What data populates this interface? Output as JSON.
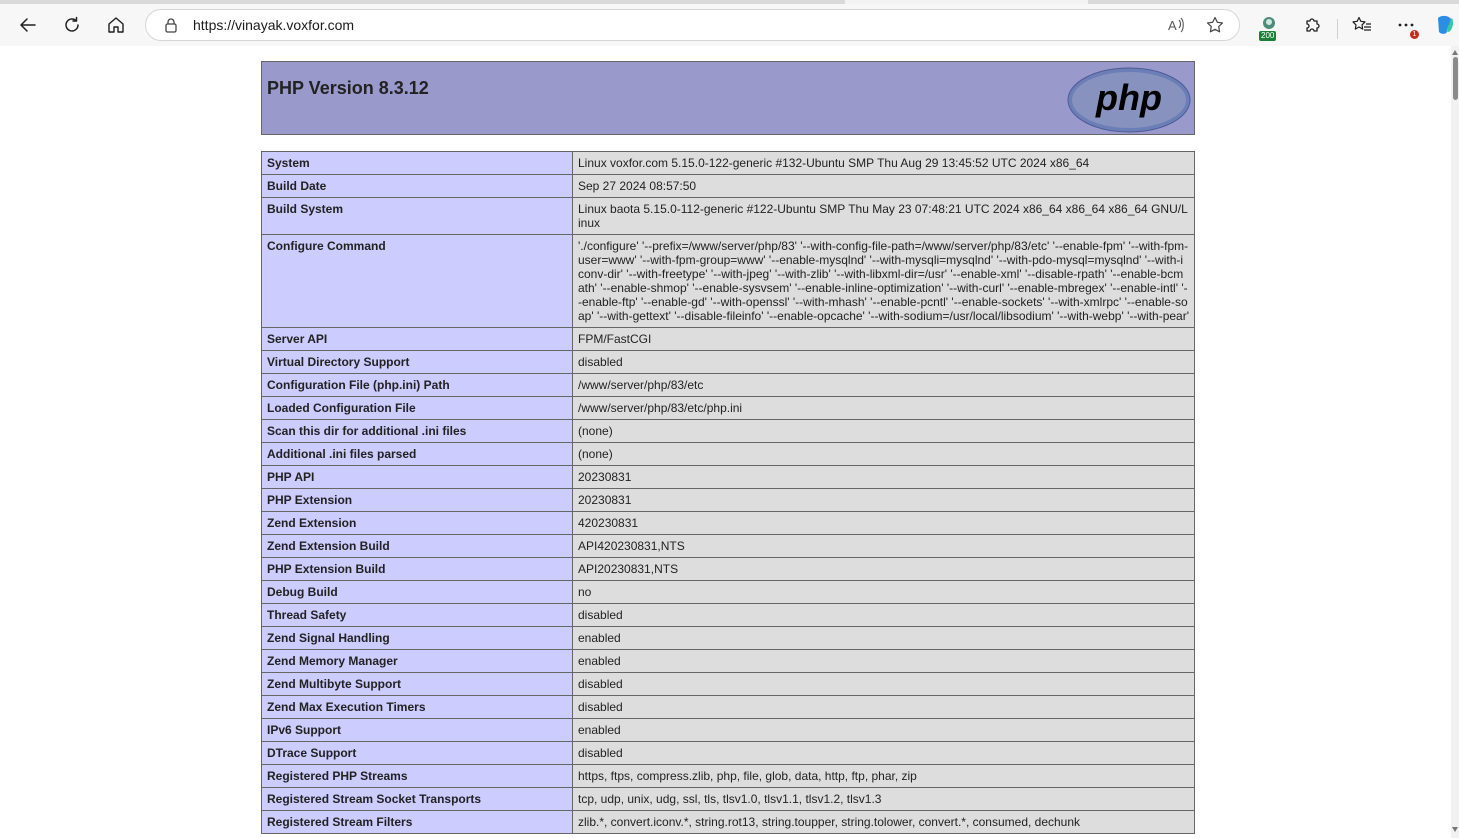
{
  "browser": {
    "url": "https://vinayak.voxfor.com",
    "extension_badge": "200",
    "menu_badge": "1",
    "toolbar_icons": [
      "back-icon",
      "refresh-icon",
      "home-icon",
      "lock-icon",
      "read-aloud-icon",
      "favorite-star-icon",
      "extension-icon",
      "puzzle-icon",
      "favorites-icon",
      "more-icon",
      "copilot-icon"
    ]
  },
  "page": {
    "title": "PHP Version 8.3.12",
    "logo_text": "php",
    "header_color": "#9999cc",
    "key_color": "#ccccff",
    "value_color": "#dddddd"
  },
  "rows": [
    {
      "k": "System",
      "v": "Linux voxfor.com 5.15.0-122-generic #132-Ubuntu SMP Thu Aug 29 13:45:52 UTC 2024 x86_64"
    },
    {
      "k": "Build Date",
      "v": "Sep 27 2024 08:57:50"
    },
    {
      "k": "Build System",
      "v": "Linux baota 5.15.0-112-generic #122-Ubuntu SMP Thu May 23 07:48:21 UTC 2024 x86_64 x86_64 x86_64 GNU/Linux"
    },
    {
      "k": "Configure Command",
      "v": "'./configure' '--prefix=/www/server/php/83' '--with-config-file-path=/www/server/php/83/etc' '--enable-fpm' '--with-fpm-user=www' '--with-fpm-group=www' '--enable-mysqlnd' '--with-mysqli=mysqlnd' '--with-pdo-mysql=mysqlnd' '--with-iconv-dir' '--with-freetype' '--with-jpeg' '--with-zlib' '--with-libxml-dir=/usr' '--enable-xml' '--disable-rpath' '--enable-bcmath' '--enable-shmop' '--enable-sysvsem' '--enable-inline-optimization' '--with-curl' '--enable-mbregex' '--enable-intl' '--enable-ftp' '--enable-gd' '--with-openssl' '--with-mhash' '--enable-pcntl' '--enable-sockets' '--with-xmlrpc' '--enable-soap' '--with-gettext' '--disable-fileinfo' '--enable-opcache' '--with-sodium=/usr/local/libsodium' '--with-webp' '--with-pear'"
    },
    {
      "k": "Server API",
      "v": "FPM/FastCGI"
    },
    {
      "k": "Virtual Directory Support",
      "v": "disabled"
    },
    {
      "k": "Configuration File (php.ini) Path",
      "v": "/www/server/php/83/etc"
    },
    {
      "k": "Loaded Configuration File",
      "v": "/www/server/php/83/etc/php.ini"
    },
    {
      "k": "Scan this dir for additional .ini files",
      "v": "(none)"
    },
    {
      "k": "Additional .ini files parsed",
      "v": "(none)"
    },
    {
      "k": "PHP API",
      "v": "20230831"
    },
    {
      "k": "PHP Extension",
      "v": "20230831"
    },
    {
      "k": "Zend Extension",
      "v": "420230831"
    },
    {
      "k": "Zend Extension Build",
      "v": "API420230831,NTS"
    },
    {
      "k": "PHP Extension Build",
      "v": "API20230831,NTS"
    },
    {
      "k": "Debug Build",
      "v": "no"
    },
    {
      "k": "Thread Safety",
      "v": "disabled"
    },
    {
      "k": "Zend Signal Handling",
      "v": "enabled"
    },
    {
      "k": "Zend Memory Manager",
      "v": "enabled"
    },
    {
      "k": "Zend Multibyte Support",
      "v": "disabled"
    },
    {
      "k": "Zend Max Execution Timers",
      "v": "disabled"
    },
    {
      "k": "IPv6 Support",
      "v": "enabled"
    },
    {
      "k": "DTrace Support",
      "v": "disabled"
    },
    {
      "k": "Registered PHP Streams",
      "v": "https, ftps, compress.zlib, php, file, glob, data, http, ftp, phar, zip"
    },
    {
      "k": "Registered Stream Socket Transports",
      "v": "tcp, udp, unix, udg, ssl, tls, tlsv1.0, tlsv1.1, tlsv1.2, tlsv1.3"
    },
    {
      "k": "Registered Stream Filters",
      "v": "zlib.*, convert.iconv.*, string.rot13, string.toupper, string.tolower, convert.*, consumed, dechunk"
    }
  ]
}
